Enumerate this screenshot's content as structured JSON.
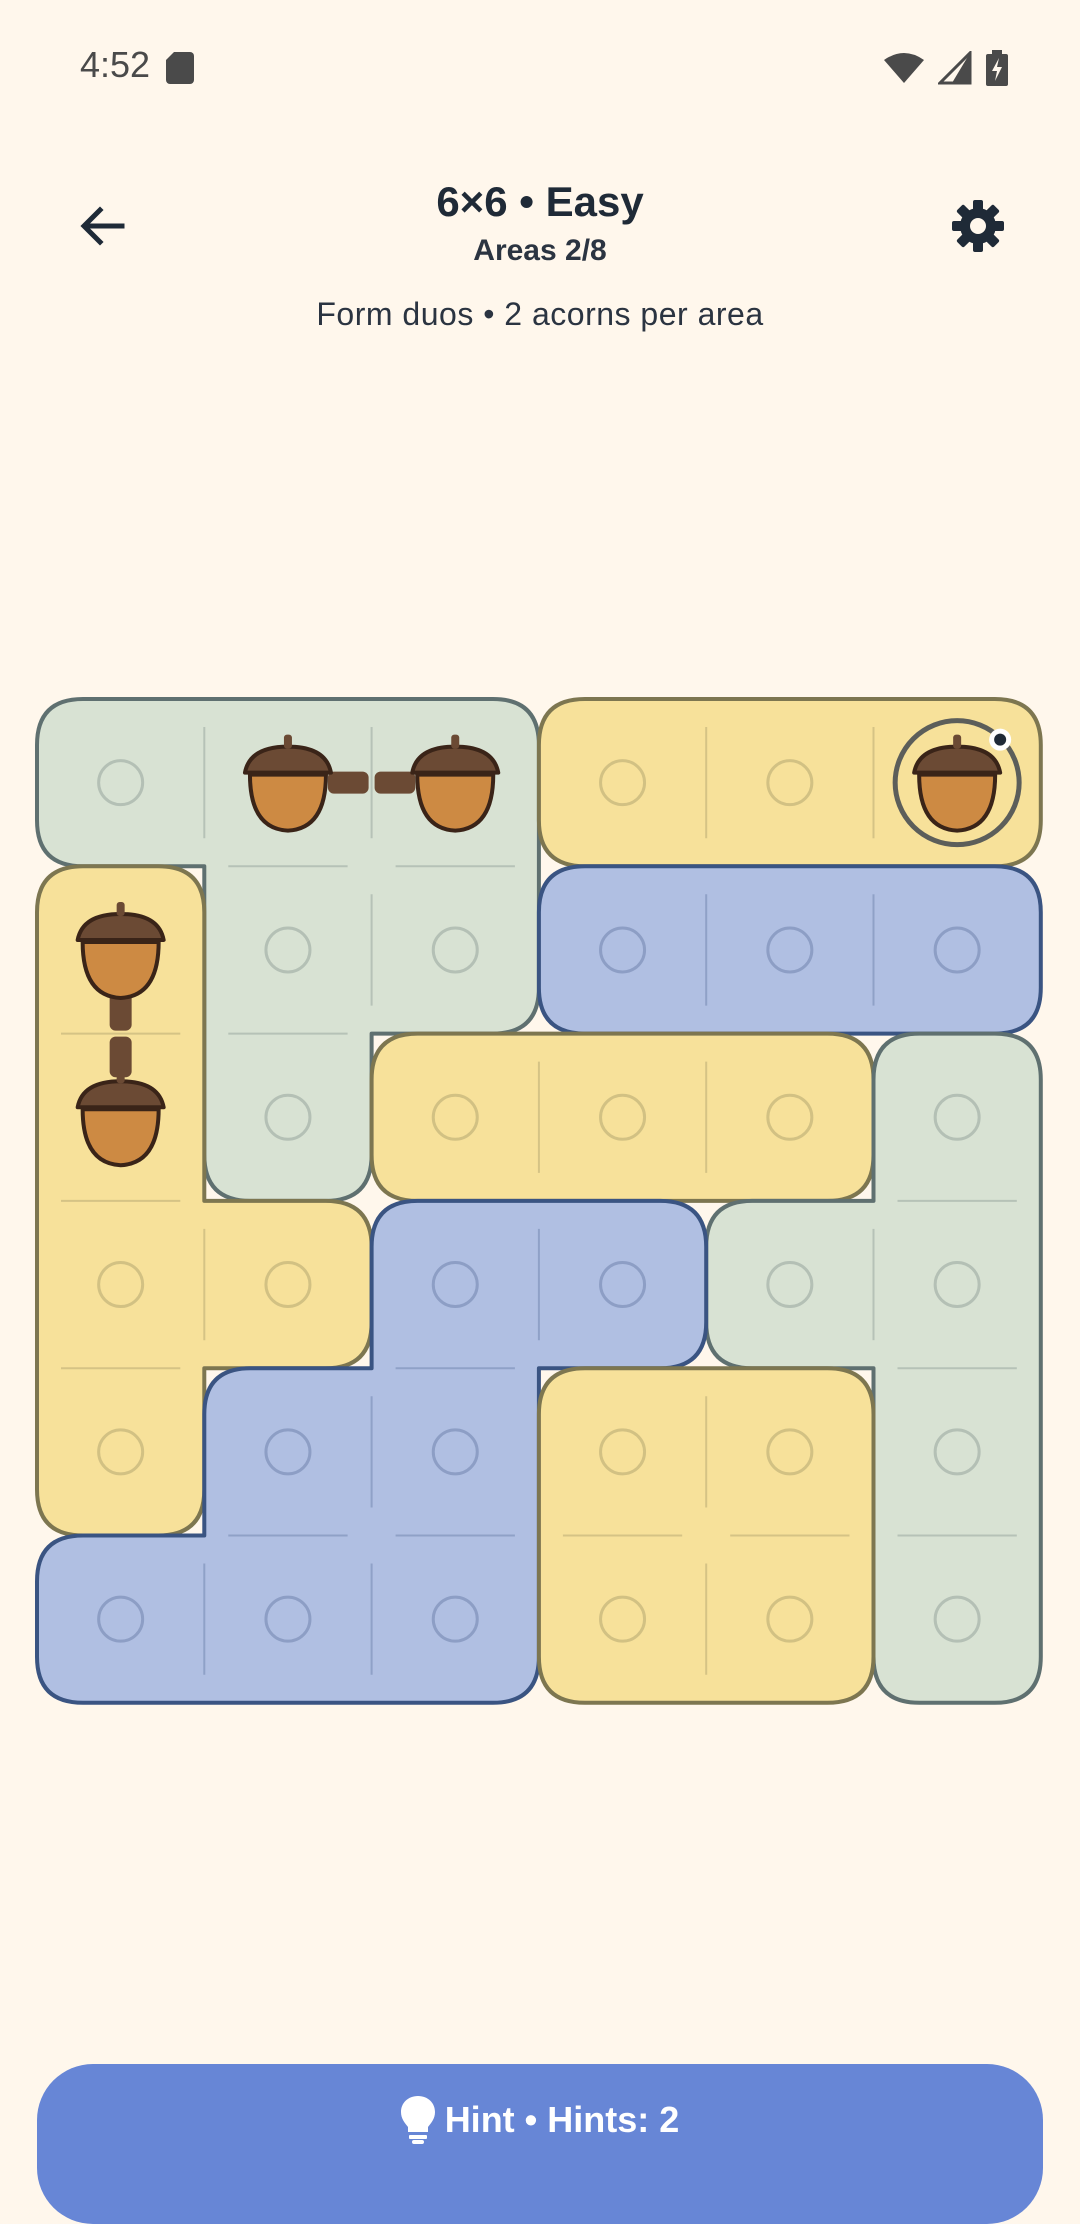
{
  "status": {
    "time": "4:52"
  },
  "header": {
    "title": "6×6 • Easy",
    "subtitle": "Areas 2/8",
    "rules": "Form duos • 2 acorns per area"
  },
  "hint": {
    "label": "Hint • Hints: 2"
  },
  "colors": {
    "background": "#fff7ec",
    "green_fill": "#d8e2d3",
    "green_border": "#5f7070",
    "yellow_fill": "#f7e19a",
    "yellow_border": "#7d7650",
    "blue_fill": "#b0bfe2",
    "blue_border": "#3a5482",
    "acorn_body": "#cd8a43",
    "acorn_cap": "#6b4a34",
    "acorn_link": "#6b4a34",
    "hint_button": "#6786d6"
  },
  "board": {
    "rows": 6,
    "cols": 6,
    "regions": [
      {
        "id": 1,
        "color": "green",
        "cells": [
          [
            0,
            0
          ],
          [
            0,
            1
          ],
          [
            0,
            2
          ],
          [
            1,
            1
          ],
          [
            1,
            2
          ],
          [
            2,
            1
          ]
        ]
      },
      {
        "id": 2,
        "color": "yellow",
        "cells": [
          [
            0,
            3
          ],
          [
            0,
            4
          ],
          [
            0,
            5
          ]
        ]
      },
      {
        "id": 3,
        "color": "blue",
        "cells": [
          [
            1,
            3
          ],
          [
            1,
            4
          ],
          [
            1,
            5
          ]
        ]
      },
      {
        "id": 4,
        "color": "yellow",
        "cells": [
          [
            1,
            0
          ],
          [
            2,
            0
          ],
          [
            3,
            0
          ],
          [
            3,
            1
          ],
          [
            4,
            0
          ]
        ]
      },
      {
        "id": 5,
        "color": "yellow",
        "cells": [
          [
            2,
            2
          ],
          [
            2,
            3
          ],
          [
            2,
            4
          ]
        ]
      },
      {
        "id": 6,
        "color": "green",
        "cells": [
          [
            2,
            5
          ],
          [
            3,
            4
          ],
          [
            3,
            5
          ],
          [
            4,
            5
          ],
          [
            5,
            5
          ]
        ]
      },
      {
        "id": 7,
        "color": "blue",
        "cells": [
          [
            3,
            2
          ],
          [
            3,
            3
          ],
          [
            4,
            1
          ],
          [
            4,
            2
          ],
          [
            5,
            0
          ],
          [
            5,
            1
          ],
          [
            5,
            2
          ]
        ]
      },
      {
        "id": 8,
        "color": "yellow",
        "cells": [
          [
            4,
            3
          ],
          [
            4,
            4
          ],
          [
            5,
            3
          ],
          [
            5,
            4
          ]
        ]
      }
    ],
    "acorns": [
      [
        0,
        1
      ],
      [
        0,
        2
      ],
      [
        0,
        5
      ],
      [
        1,
        0
      ],
      [
        2,
        0
      ]
    ],
    "links": [
      [
        [
          0,
          1
        ],
        [
          0,
          2
        ]
      ],
      [
        [
          1,
          0
        ],
        [
          2,
          0
        ]
      ]
    ],
    "selected": [
      0,
      5
    ]
  }
}
